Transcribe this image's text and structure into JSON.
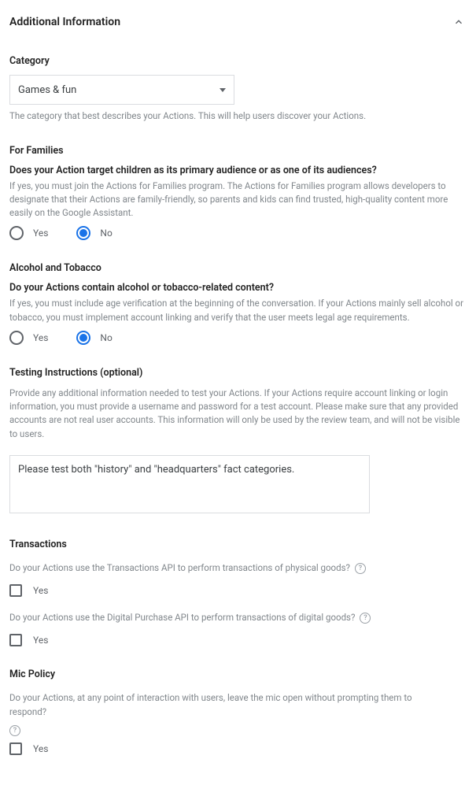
{
  "header": {
    "title": "Additional Information"
  },
  "category": {
    "label": "Category",
    "selected": "Games & fun",
    "helper": "The category that best describes your Actions. This will help users discover your Actions."
  },
  "families": {
    "label": "For Families",
    "question": "Does your Action target children as its primary audience or as one of its audiences?",
    "description": "If yes, you must join the Actions for Families program. The Actions for Families program allows developers to designate that their Actions are family-friendly, so parents and kids can find trusted, high-quality content more easily on the Google Assistant.",
    "yes": "Yes",
    "no": "No"
  },
  "alcohol": {
    "label": "Alcohol and Tobacco",
    "question": "Do your Actions contain alcohol or tobacco-related content?",
    "description": "If yes, you must include age verification at the beginning of the conversation. If your Actions mainly sell alcohol or tobacco, you must implement account linking and verify that the user meets legal age requirements.",
    "yes": "Yes",
    "no": "No"
  },
  "testing": {
    "label": "Testing Instructions (optional)",
    "description": "Provide any additional information needed to test your Actions. If your Actions require account linking or login information, you must provide a username and password for a test account. Please make sure that any provided accounts are not real user accounts. This information will only be used by the review team, and will not be visible to users.",
    "value": "Please test both \"history\" and \"headquarters\" fact categories."
  },
  "transactions": {
    "label": "Transactions",
    "physical_question": "Do your Actions use the Transactions API to perform transactions of physical goods?",
    "digital_question": "Do your Actions use the Digital Purchase API to perform transactions of digital goods?",
    "yes": "Yes"
  },
  "mic": {
    "label": "Mic Policy",
    "question": "Do your Actions, at any point of interaction with users, leave the mic open without prompting them to respond?",
    "yes": "Yes"
  }
}
